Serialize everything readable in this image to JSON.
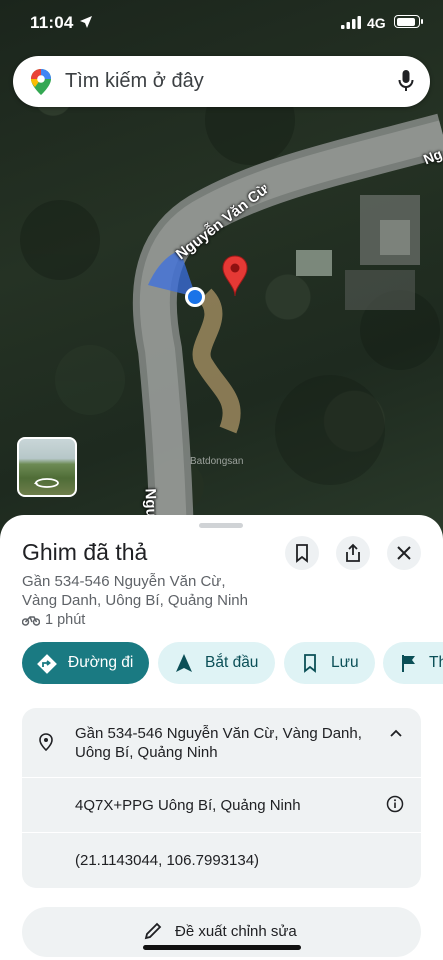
{
  "status_bar": {
    "time": "11:04",
    "network": "4G",
    "battery_level": 0.9
  },
  "search": {
    "placeholder": "Tìm kiếm ở đây"
  },
  "map": {
    "street_labels": [
      "Nguyễn Văn Cừ",
      "Nguyễn",
      "Ng"
    ],
    "watermark": "Batdongsan"
  },
  "place": {
    "title": "Ghim đã thả",
    "address_line1": "Gần 534-546 Nguyễn Văn Cừ,",
    "address_line2": "Vàng Danh, Uông Bí, Quảng Ninh",
    "travel_time": "1 phút"
  },
  "actions": [
    {
      "label": "Đường đi",
      "icon": "directions-icon"
    },
    {
      "label": "Bắt đầu",
      "icon": "navigation-arrow-icon"
    },
    {
      "label": "Lưu",
      "icon": "bookmark-icon"
    },
    {
      "label": "Th",
      "icon": "flag-icon"
    }
  ],
  "details": {
    "address_line1": "Gần 534-546 Nguyễn Văn Cừ, Vàng Danh,",
    "address_line2": "Uông Bí, Quảng Ninh",
    "plus_code": "4Q7X+PPG Uông Bí, Quảng Ninh",
    "coordinates": "(21.1143044, 106.7993134)"
  },
  "suggest_edit": {
    "label": "Đề xuất chỉnh sửa"
  },
  "colors": {
    "primary": "#1a7a82",
    "chip_bg": "#dff3f5",
    "chip_text": "#0b4f57",
    "pin_red": "#e53935",
    "location_blue": "#1a73e8"
  }
}
